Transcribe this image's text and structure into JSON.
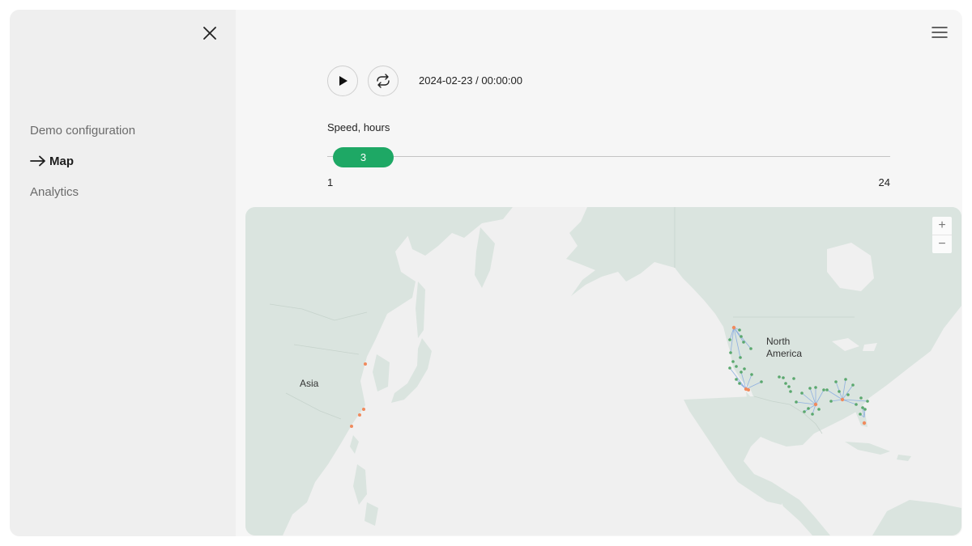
{
  "sidebar": {
    "items": [
      {
        "label": "Demo configuration",
        "active": false
      },
      {
        "label": "Map",
        "active": true
      },
      {
        "label": "Analytics",
        "active": false
      }
    ]
  },
  "player": {
    "timestamp": "2024-02-23 / 00:00:00"
  },
  "speed": {
    "label": "Speed, hours",
    "value": "3",
    "min": "1",
    "max": "24"
  },
  "map": {
    "labels": {
      "asia": "Asia",
      "north_america_line1": "North",
      "north_america_line2": "America"
    },
    "zoom_in": "+",
    "zoom_out": "−"
  },
  "colors": {
    "accent": "#1ea865",
    "land": "#dae4df",
    "water": "#f0f0f0",
    "origin_point": "#f08a5d",
    "destination_point": "#5aa86e",
    "route_line": "#8fb0e0"
  }
}
